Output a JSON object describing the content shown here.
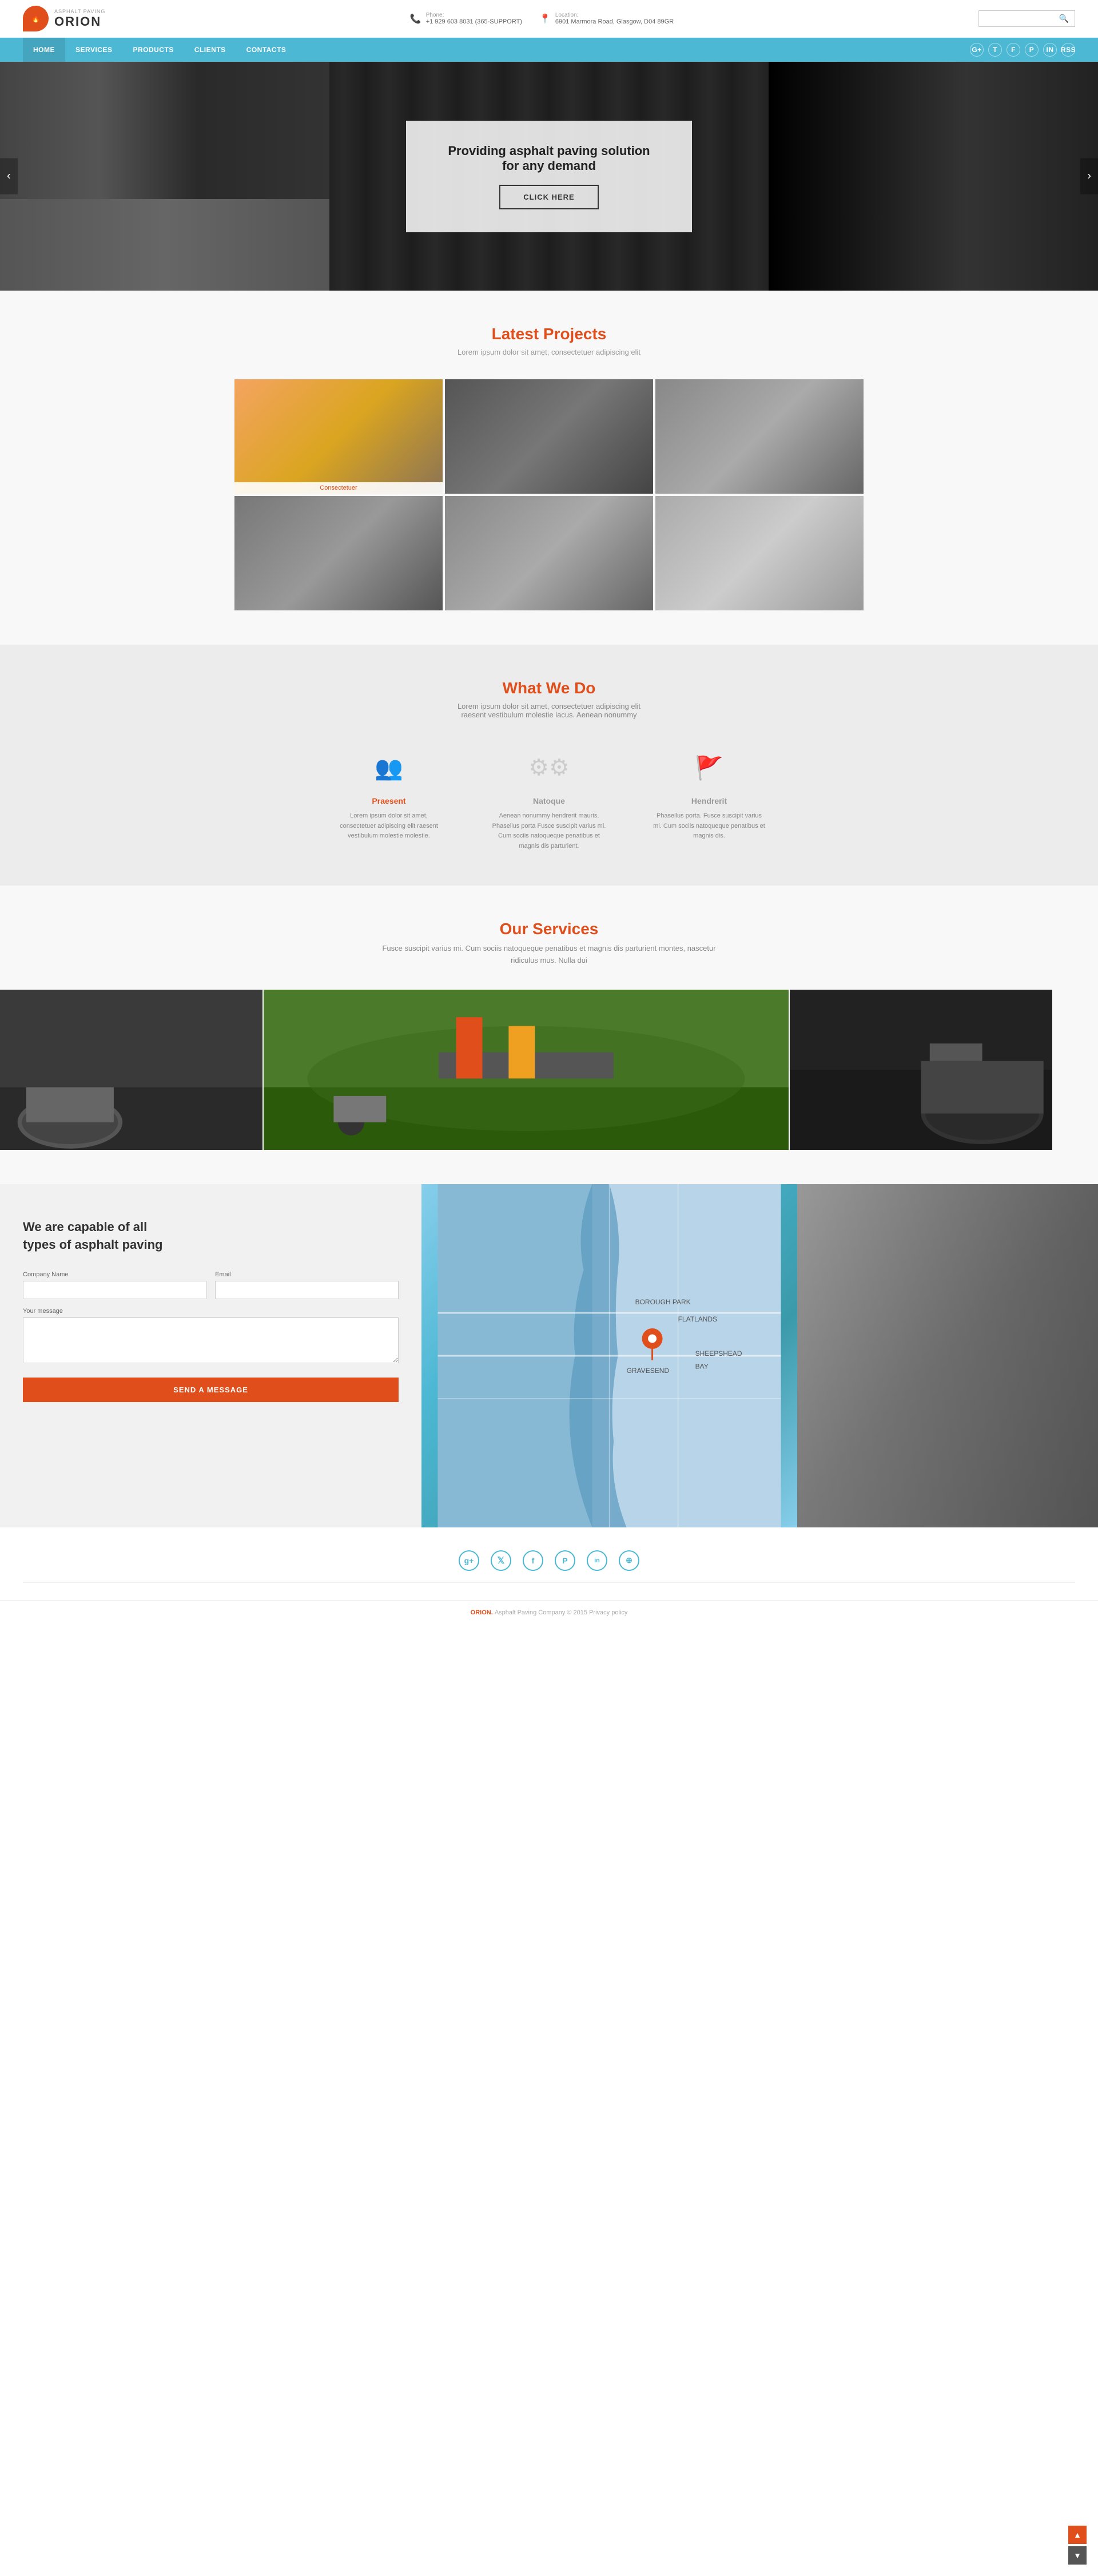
{
  "brand": {
    "tagline": "Asphalt paving",
    "name": "ORION"
  },
  "topbar": {
    "phone_label": "Phone:",
    "phone_number": "+1 929 603 8031 (365-SUPPORT)",
    "location_label": "Location:",
    "location_address": "6901 Marmora Road\nGlasgow, D04 89GR",
    "search_placeholder": ""
  },
  "nav": {
    "items": [
      {
        "label": "HOME",
        "active": true
      },
      {
        "label": "SERVICES",
        "active": false
      },
      {
        "label": "PRODUCTS",
        "active": false
      },
      {
        "label": "CLIENTS",
        "active": false
      },
      {
        "label": "CONTACTS",
        "active": false
      }
    ],
    "social": [
      "g+",
      "t",
      "f",
      "p",
      "in",
      "rss"
    ]
  },
  "hero": {
    "headline": "Providing asphalt paving solution for any demand",
    "cta_label": "CLICK HERE"
  },
  "latest_projects": {
    "title": "Latest Projects",
    "subtitle": "Lorem ipsum dolor sit amet, consectetuer adipiscing elit",
    "items": [
      {
        "label": "Consectetuer",
        "highlighted": true
      },
      {
        "label": "",
        "highlighted": false
      },
      {
        "label": "",
        "highlighted": false
      },
      {
        "label": "",
        "highlighted": false
      },
      {
        "label": "",
        "highlighted": false
      },
      {
        "label": "",
        "highlighted": false
      }
    ]
  },
  "what_we_do": {
    "title": "What We Do",
    "subtitle": "Lorem ipsum dolor sit amet, consectetuer adipiscing elit\nraesent vestibulum molestie lacus. Aenean nonummy",
    "services": [
      {
        "icon": "👥",
        "title": "Praesent",
        "desc": "Lorem ipsum dolor sit amet, consectetuer adipiscing elit raesent vestibulum molestie molestie."
      },
      {
        "icon": "⚙",
        "title": "Natoque",
        "desc": "Aenean nonummy hendrerit mauris. Phasellus porta Fusce suscipit varius mi. Cum sociis natoqueque penatibus et magnis dis parturient."
      },
      {
        "icon": "🚩",
        "title": "Hendrerit",
        "desc": "Phasellus porta. Fusce suscipit varius mi. Cum sociis natoqueque penatibus et magnis dis."
      }
    ]
  },
  "our_services": {
    "title": "Our Services",
    "subtitle": "Fusce suscipit varius mi. Cum sociis natoqueque penatibus et magnis dis parturient montes, nascetur ridiculus mus. Nulla dui"
  },
  "contact": {
    "heading": "We are capable of all\ntypes of asphalt paving",
    "form": {
      "company_label": "Company Name",
      "email_label": "Email",
      "message_label": "Your message",
      "send_label": "SEND A MESSAGE"
    }
  },
  "footer": {
    "social_icons": [
      {
        "name": "google-plus",
        "symbol": "g+"
      },
      {
        "name": "twitter",
        "symbol": "𝕏"
      },
      {
        "name": "facebook",
        "symbol": "f"
      },
      {
        "name": "pinterest",
        "symbol": "P"
      },
      {
        "name": "linkedin",
        "symbol": "in"
      },
      {
        "name": "rss",
        "symbol": "⊕"
      }
    ],
    "copyright": "ORION. Asphalt Paving Company © 2015 Privacy policy"
  },
  "scroll": {
    "up_label": "▲",
    "down_label": "▼"
  }
}
